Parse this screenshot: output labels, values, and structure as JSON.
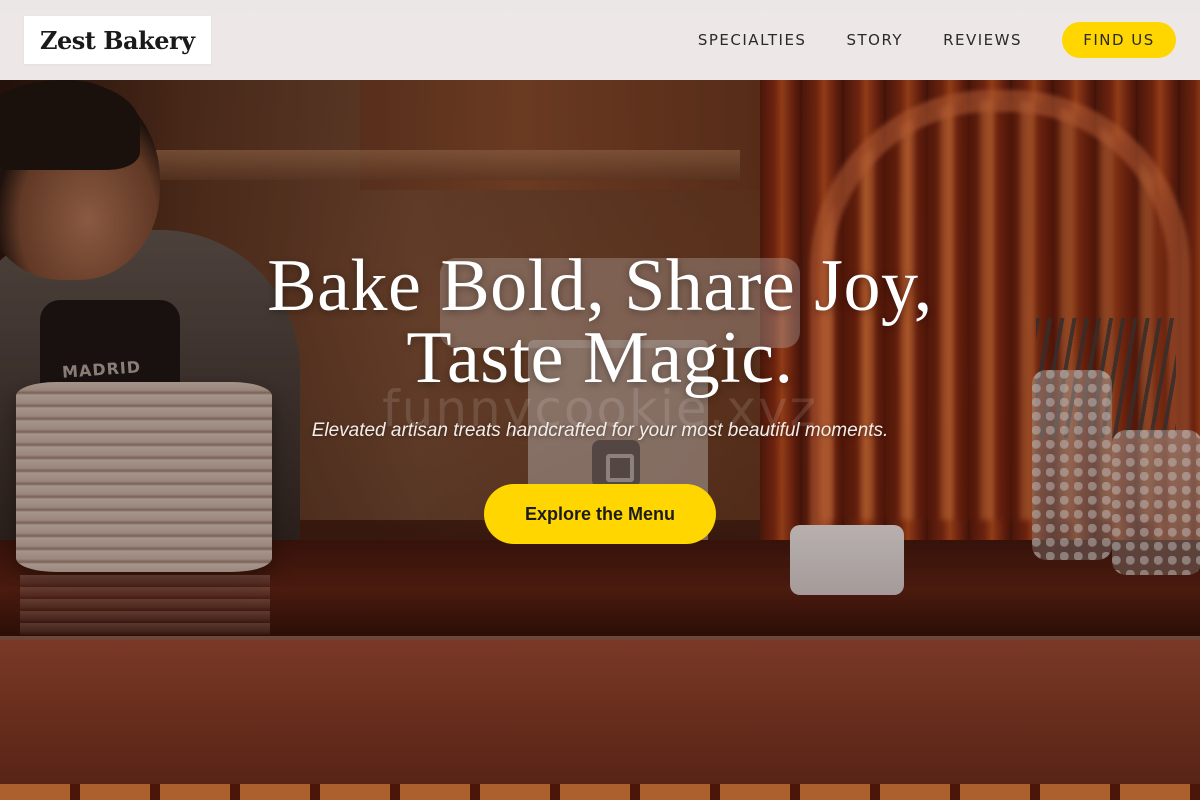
{
  "header": {
    "logo_text": "Zest Bakery",
    "nav": [
      {
        "label": "SPECIALTIES"
      },
      {
        "label": "STORY"
      },
      {
        "label": "REVIEWS"
      }
    ],
    "cta_label": "FIND US"
  },
  "hero": {
    "headline_line1": "Bake Bold, Share Joy,",
    "headline_line2": "Taste Magic.",
    "subtitle": "Elevated artisan treats handcrafted for your most beautiful moments.",
    "cta_label": "Explore the Menu",
    "watermark": "funnycookie.xyz",
    "apron_text": "MADRID"
  },
  "colors": {
    "accent": "#ffd600",
    "header_bg": "#f8f4f4",
    "headline": "#ffffff"
  }
}
